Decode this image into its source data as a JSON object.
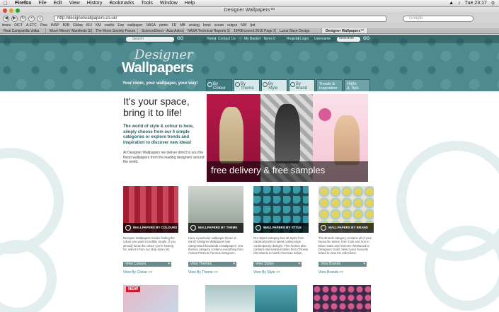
{
  "os": {
    "app_name": "Firefox",
    "menus": [
      "File",
      "Edit",
      "View",
      "History",
      "Bookmarks",
      "Tools",
      "Window",
      "Help"
    ],
    "clock": "Tue 23:17"
  },
  "window": {
    "title": "Designer Wallpapers™"
  },
  "toolbar": {
    "url": "http://designerwallpapers.co.uk/",
    "search_placeholder": "Google"
  },
  "bookmarks": [
    "itrans",
    "DICT",
    "A-ETC",
    "Dive",
    "INSP",
    "B2B",
    "GMap",
    "ISU",
    "KM",
    "cavillo",
    "Exp",
    "wallpaper",
    "NASA",
    "pietro",
    "FR",
    "MB",
    "analog",
    "hotel",
    "ocean",
    "output",
    "NW",
    "fpd"
  ],
  "tabs": [
    {
      "label": "Real Campanilla Volka",
      "active": false
    },
    {
      "label": "Moon Miners' Manifesto Sit",
      "active": false
    },
    {
      "label": "The Moon Society Forum",
      "active": false
    },
    {
      "label": "ScienceDirect - Acta Astron.",
      "active": false
    },
    {
      "label": "NASA Technical Reports Ser.",
      "active": false
    },
    {
      "label": "1940Ecoconf.2616 Page 369",
      "active": false
    },
    {
      "label": "Lunar Base Design",
      "active": false
    },
    {
      "label": "Designer Wallpapers™",
      "active": true
    }
  ],
  "site": {
    "search_placeholder": "Search",
    "go": "GO",
    "home": "Home",
    "sep": "|",
    "contact": "Contact Us",
    "basket": "My Basket : Items 0",
    "register": "Register",
    "login": "Login",
    "username": "Username",
    "password": "••••••••••",
    "logo_top": "Designer",
    "logo_bottom": "Wallpapers",
    "tagline": "Your room, your wallpaper, your way!",
    "nav": [
      {
        "l1": "By",
        "l2": "Colour"
      },
      {
        "l1": "By",
        "l2": "Theme"
      },
      {
        "l1": "By",
        "l2": "Style"
      },
      {
        "l1": "By",
        "l2": "Brand"
      },
      {
        "l1": "Trends &",
        "l2": "Inspiration"
      },
      {
        "l1": "Hints",
        "l2": "& Tips"
      }
    ]
  },
  "hero": {
    "title_line1": "It's your space,",
    "title_line2": "bring it to life!",
    "subtitle": "The world of style & colour is here, simply choose from our 4 simple categories or explore trends and inspiration to discover new ideas!",
    "body": "At Designer Wallpapers we deliver direct to you the finest wallpapers from the leading designers around the world.",
    "banner_text": "free delivery & free samples"
  },
  "cards": [
    {
      "label": "WALLPAPERS BY COLOURS",
      "text": "Designer Wallpapers makes finding the colour you want incredibly simple. If you already know the colour you're looking for, select it from our drop down list.",
      "select": "View Colours",
      "link": "View By Colour >>"
    },
    {
      "label": "WALLPAPERS BY THEME",
      "text": "Have a particular wallpaper theme in mind? Designer Wallpapers has categorised thousands of wallpapers. Our themes category contains everything from Animal Prints to Famous Designers.",
      "select": "View Themes",
      "link": "View By Theme >>"
    },
    {
      "label": "WALLPAPERS BY STYLE",
      "text": "Our Styles category has all styles from classical prints to latest cutting edge contemporary designs. This section also contains international styles from Chinese Chinoiserie to North American Indian.",
      "select": "View Styles",
      "link": "View By Style >>"
    },
    {
      "label": "WALLPAPERS BY BRAND",
      "text": "The Brands category contains all of your favourite names, from Cole and Son to Brian Yates and Vivienne Westwood to Designers Guild. Select your favourite brand to view the collections.",
      "select": "View Brands",
      "link": "View Brands >>"
    }
  ],
  "bottom": {
    "new_badge": "NEW"
  }
}
